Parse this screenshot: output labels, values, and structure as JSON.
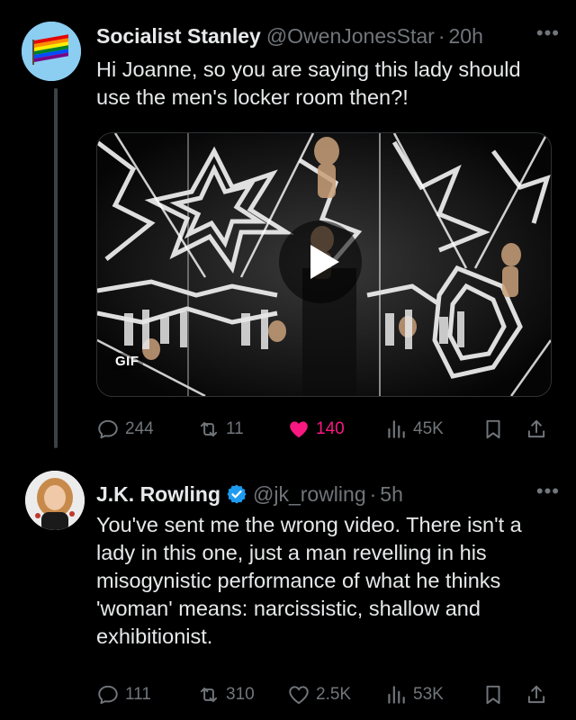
{
  "tweets": [
    {
      "author": {
        "name": "Socialist Stanley",
        "handle": "@OwenJonesStar",
        "time": "20h",
        "avatar_icon": "rainbow-flag-avatar",
        "verified": false
      },
      "text": "Hi Joanne, so you are saying this lady should use the men's locker room then?!",
      "media": {
        "type": "GIF",
        "badge": "GIF",
        "has_play_button": true
      },
      "metrics": {
        "replies": "244",
        "retweets": "11",
        "likes": "140",
        "views": "45K"
      },
      "liked": true
    },
    {
      "author": {
        "name": "J.K. Rowling",
        "handle": "@jk_rowling",
        "time": "5h",
        "avatar_icon": "person-avatar",
        "verified": true
      },
      "text": "You've sent me the wrong video. There isn't a lady in this one, just a man revelling in his misogynistic performance of what he thinks 'woman' means: narcissistic, shallow and exhibitionist.",
      "metrics": {
        "replies": "111",
        "retweets": "310",
        "likes": "2.5K",
        "views": "53K"
      },
      "liked": false
    }
  ],
  "ui": {
    "more_glyph": "•••",
    "separator": "·"
  },
  "colors": {
    "background": "#000000",
    "text": "#e7e9ea",
    "muted": "#71767b",
    "like_active": "#f91880",
    "verified": "#1d9bf0"
  }
}
